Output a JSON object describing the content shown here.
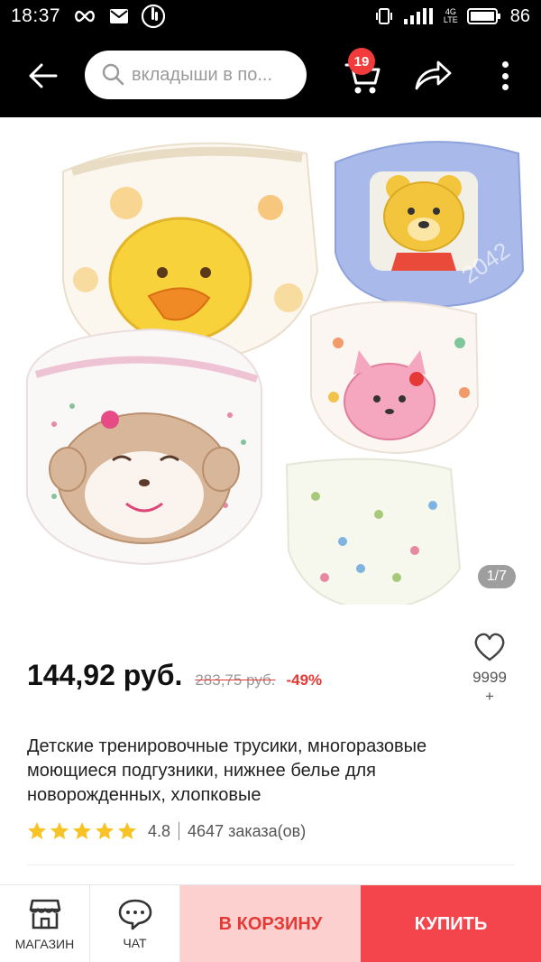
{
  "status_bar": {
    "time": "18:37",
    "battery": "86",
    "network": "4G LTE"
  },
  "header": {
    "search_placeholder": "вкладыши в по...",
    "cart_count": "19"
  },
  "gallery": {
    "counter": "1/7",
    "image_text": "2042"
  },
  "product": {
    "price": "144,92 руб.",
    "old_price": "283,75 руб.",
    "discount": "-49%",
    "wishlist_count": "9999",
    "wishlist_plus": "+",
    "title": "Детские тренировочные трусики, многоразовые моющиеся подгузники, нижнее белье для новорожденных, хлопковые",
    "rating": "4.8",
    "rating_stars": 5,
    "orders": "4647 заказа(ов)"
  },
  "bottom_bar": {
    "store_label": "МАГАЗИН",
    "chat_label": "ЧАТ",
    "add_to_cart_label": "В КОРЗИНУ",
    "buy_label": "КУПИТЬ"
  },
  "colors": {
    "accent_red": "#f5454c",
    "badge_red": "#f23b3b",
    "cart_button_bg": "#fdd0d0",
    "star_yellow": "#f7c325"
  }
}
